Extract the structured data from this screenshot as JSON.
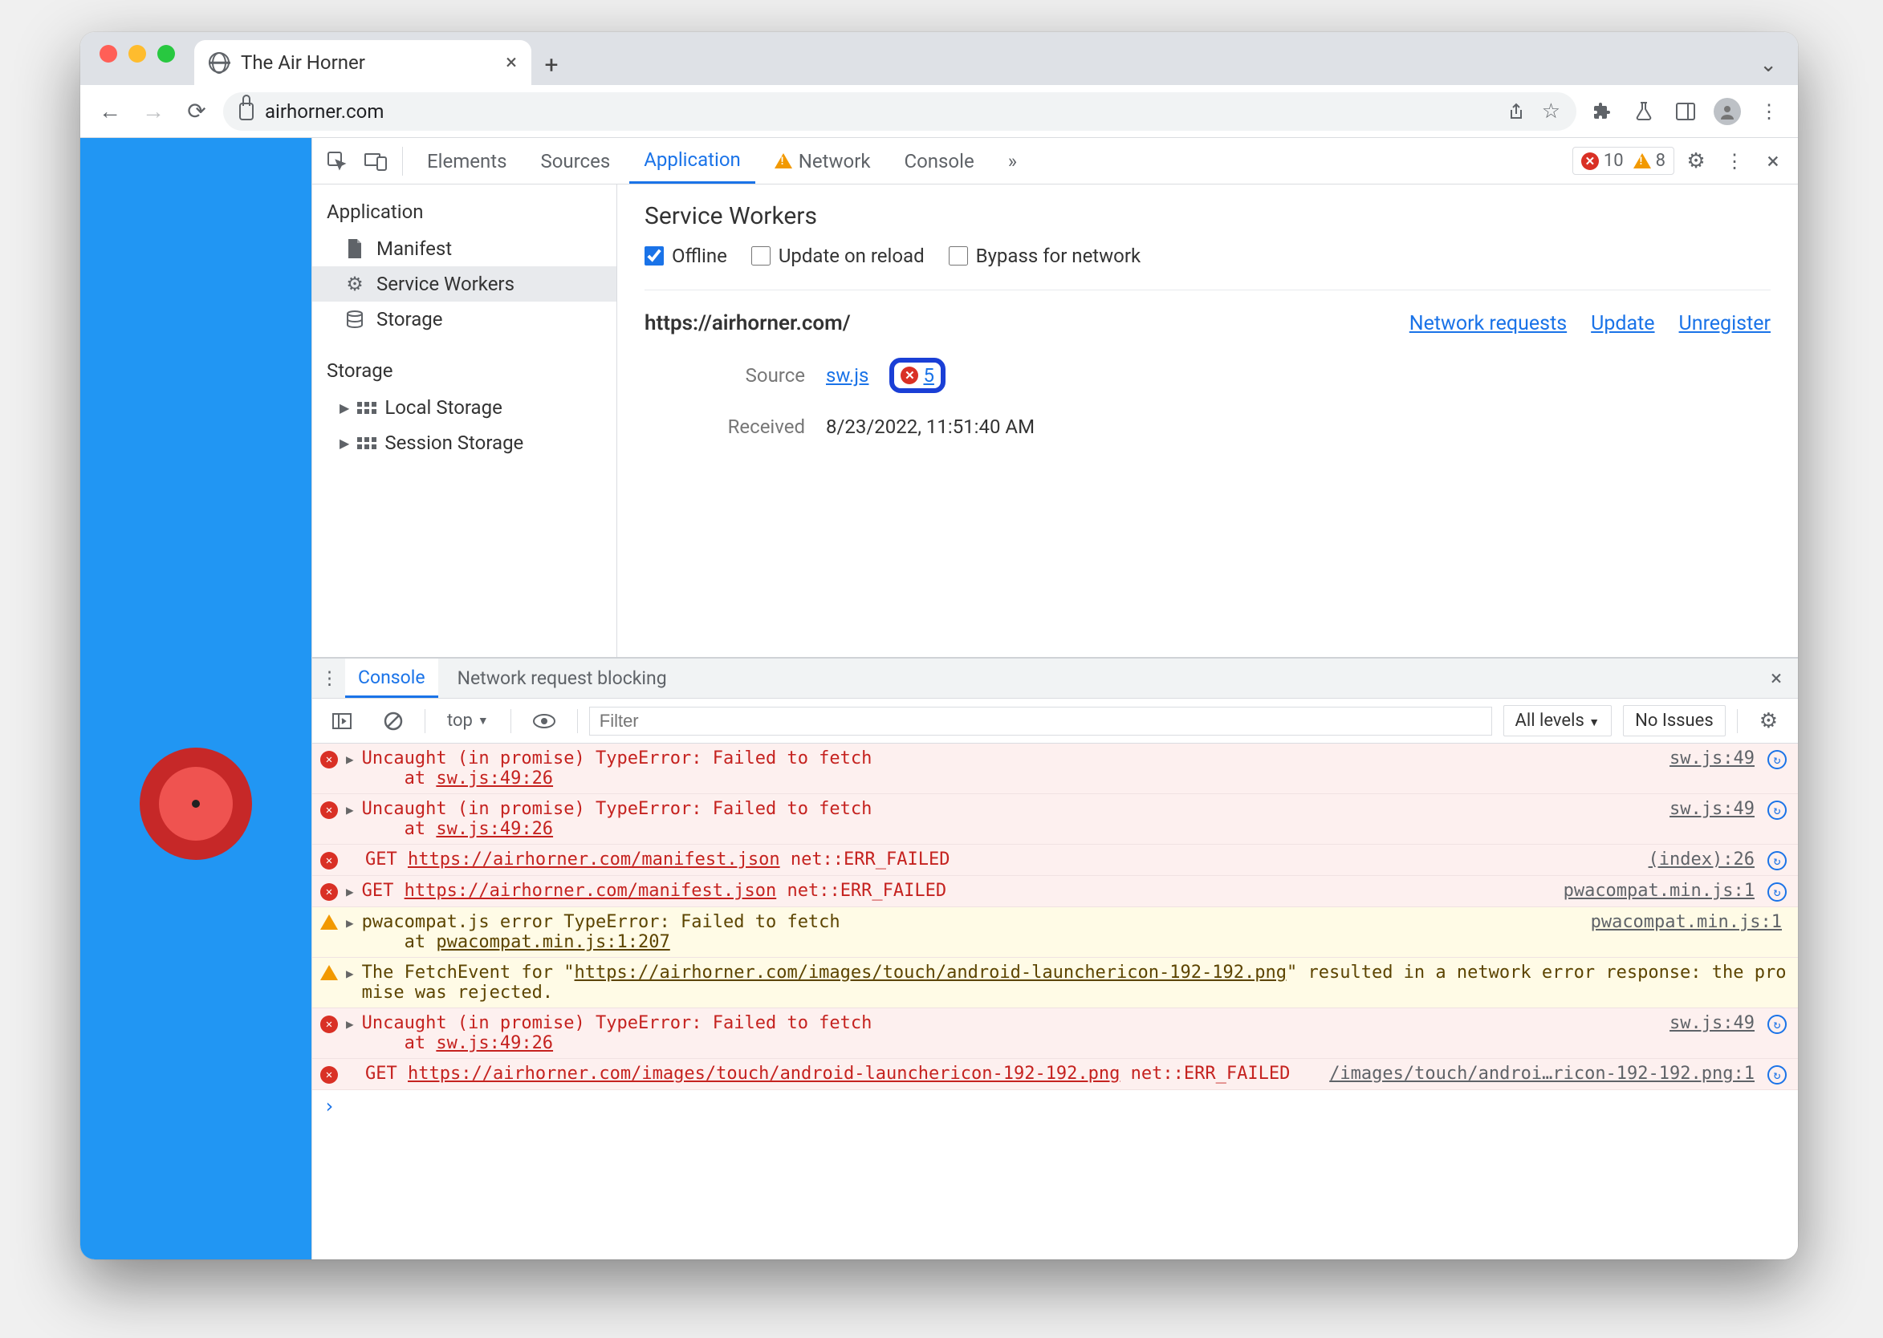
{
  "tab": {
    "title": "The Air Horner"
  },
  "omnibox": {
    "url": "airhorner.com"
  },
  "devtools_tabs": {
    "elements": "Elements",
    "sources": "Sources",
    "application": "Application",
    "network": "Network",
    "console": "Console"
  },
  "badge": {
    "errors": "10",
    "warnings": "8"
  },
  "sidebar": {
    "app_header": "Application",
    "manifest": "Manifest",
    "service_workers": "Service Workers",
    "storage": "Storage",
    "storage_header": "Storage",
    "local_storage": "Local Storage",
    "session_storage": "Session Storage"
  },
  "sw_panel": {
    "title": "Service Workers",
    "offline": "Offline",
    "update_on_reload": "Update on reload",
    "bypass": "Bypass for network",
    "origin": "https://airhorner.com/",
    "link_network": "Network requests",
    "link_update": "Update",
    "link_unregister": "Unregister",
    "source_label": "Source",
    "source_file": "sw.js",
    "error_count": "5",
    "received_label": "Received",
    "received_value": "8/23/2022, 11:51:40 AM"
  },
  "drawer": {
    "console": "Console",
    "blocking": "Network request blocking",
    "context": "top",
    "filter_placeholder": "Filter",
    "levels": "All levels",
    "no_issues": "No Issues"
  },
  "logs": [
    {
      "type": "err",
      "disclose": true,
      "msg": "Uncaught (in promise) TypeError: Failed to fetch\n    at ",
      "trace": "sw.js:49:26",
      "src": "sw.js:49",
      "nav": true
    },
    {
      "type": "err",
      "disclose": true,
      "msg": "Uncaught (in promise) TypeError: Failed to fetch\n    at ",
      "trace": "sw.js:49:26",
      "src": "sw.js:49",
      "nav": true
    },
    {
      "type": "err",
      "disclose": false,
      "prefix": "GET ",
      "url": "https://airhorner.com/manifest.json",
      "suffix": " net::ERR_FAILED",
      "src": "(index):26",
      "nav": true
    },
    {
      "type": "err",
      "disclose": true,
      "prefix": "GET ",
      "url": "https://airhorner.com/manifest.json",
      "suffix": " net::ERR_FAILED",
      "src": "pwacompat.min.js:1",
      "nav": true
    },
    {
      "type": "warn",
      "disclose": true,
      "msg": "pwacompat.js error TypeError: Failed to fetch\n    at ",
      "trace": "pwacompat.min.js:1:207",
      "src": "pwacompat.min.js:1",
      "nav": false
    },
    {
      "type": "warn",
      "disclose": true,
      "msg": "The FetchEvent for \"",
      "url": "https://airhorner.com/images/touch/android-launchericon-192-192.png",
      "suffix": "\" resulted in a network error response: the promise was rejected.",
      "src": "",
      "nav": false
    },
    {
      "type": "err",
      "disclose": true,
      "msg": "Uncaught (in promise) TypeError: Failed to fetch\n    at ",
      "trace": "sw.js:49:26",
      "src": "sw.js:49",
      "nav": true
    },
    {
      "type": "err",
      "disclose": false,
      "prefix": "GET ",
      "url": "https://airhorner.com/images/touch/android-launchericon-192-192.png",
      "suffix": " net::ERR_FAILED",
      "src": "/images/touch/androi…ricon-192-192.png:1",
      "nav": true
    }
  ]
}
